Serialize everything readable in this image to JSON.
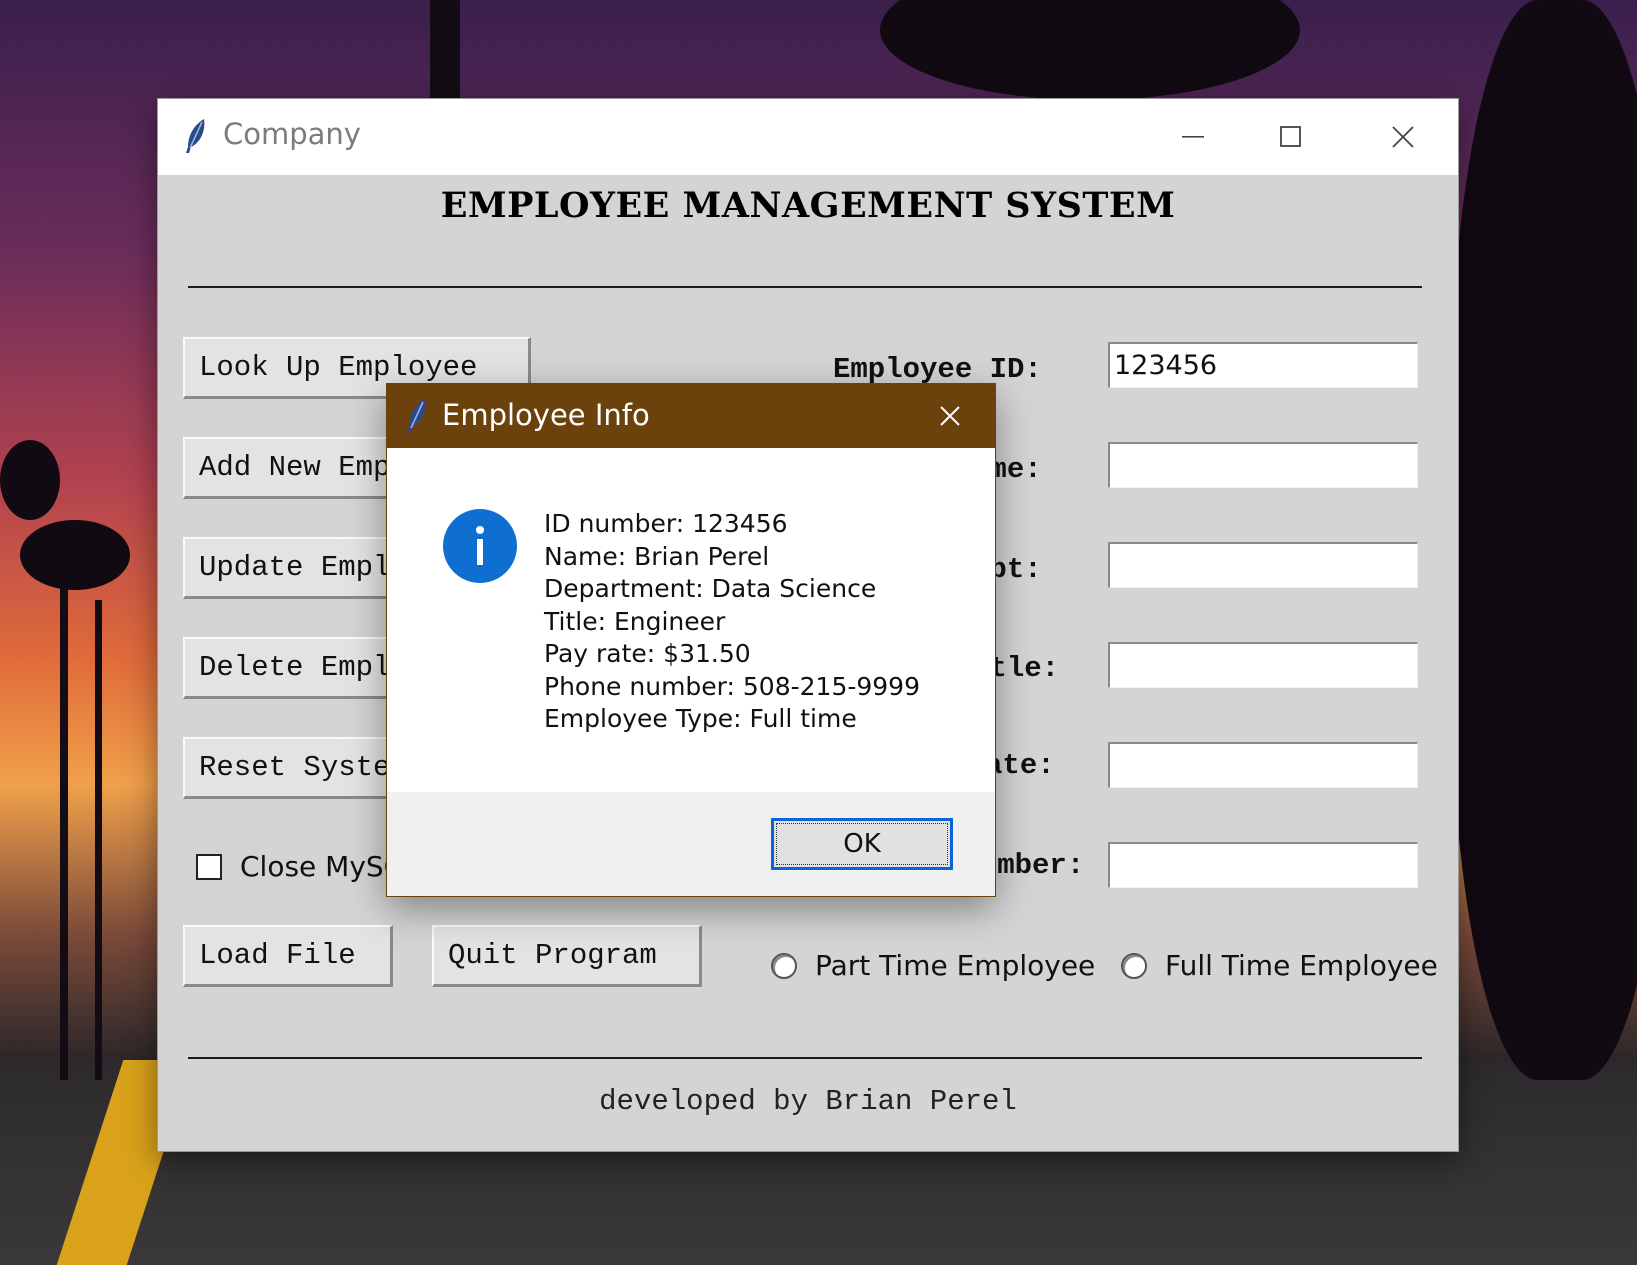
{
  "main_window": {
    "title": "Company",
    "heading": "EMPLOYEE MANAGEMENT SYSTEM",
    "buttons": {
      "look_up": "Look Up Employee",
      "add_new": "Add New Employee",
      "update": "Update Employee",
      "delete": "Delete Employee",
      "reset": "Reset System",
      "load_file": "Load File",
      "quit": "Quit Program"
    },
    "close_checkbox_label": "Close MySQL",
    "fields": {
      "employee_id": {
        "label": "Employee ID:",
        "value": "123456"
      },
      "name": {
        "label": "Employee Name:",
        "value": ""
      },
      "dept": {
        "label": "Employee Dept:",
        "value": ""
      },
      "title": {
        "label": "Employee Title:",
        "value": ""
      },
      "pay_rate": {
        "label": "Pay Rate:",
        "value": ""
      },
      "phone": {
        "label": "Phone Number:",
        "value": ""
      }
    },
    "radio_part_time": "Part Time Employee",
    "radio_full_time": "Full Time Employee",
    "footer": "developed by Brian Perel"
  },
  "dialog": {
    "title": "Employee Info",
    "lines": [
      "ID number: 123456",
      "Name: Brian Perel",
      "Department: Data Science",
      "Title: Engineer",
      "Pay rate: $31.50",
      "Phone number: 508-215-9999",
      "Employee Type: Full time"
    ],
    "ok_label": "OK"
  },
  "colors": {
    "dialog_titlebar": "#6b410c",
    "info_icon": "#0e6fd1",
    "window_bg": "#d4d4d4"
  },
  "icons": [
    "feather-icon",
    "minimize-icon",
    "maximize-icon",
    "close-icon",
    "info-icon"
  ]
}
